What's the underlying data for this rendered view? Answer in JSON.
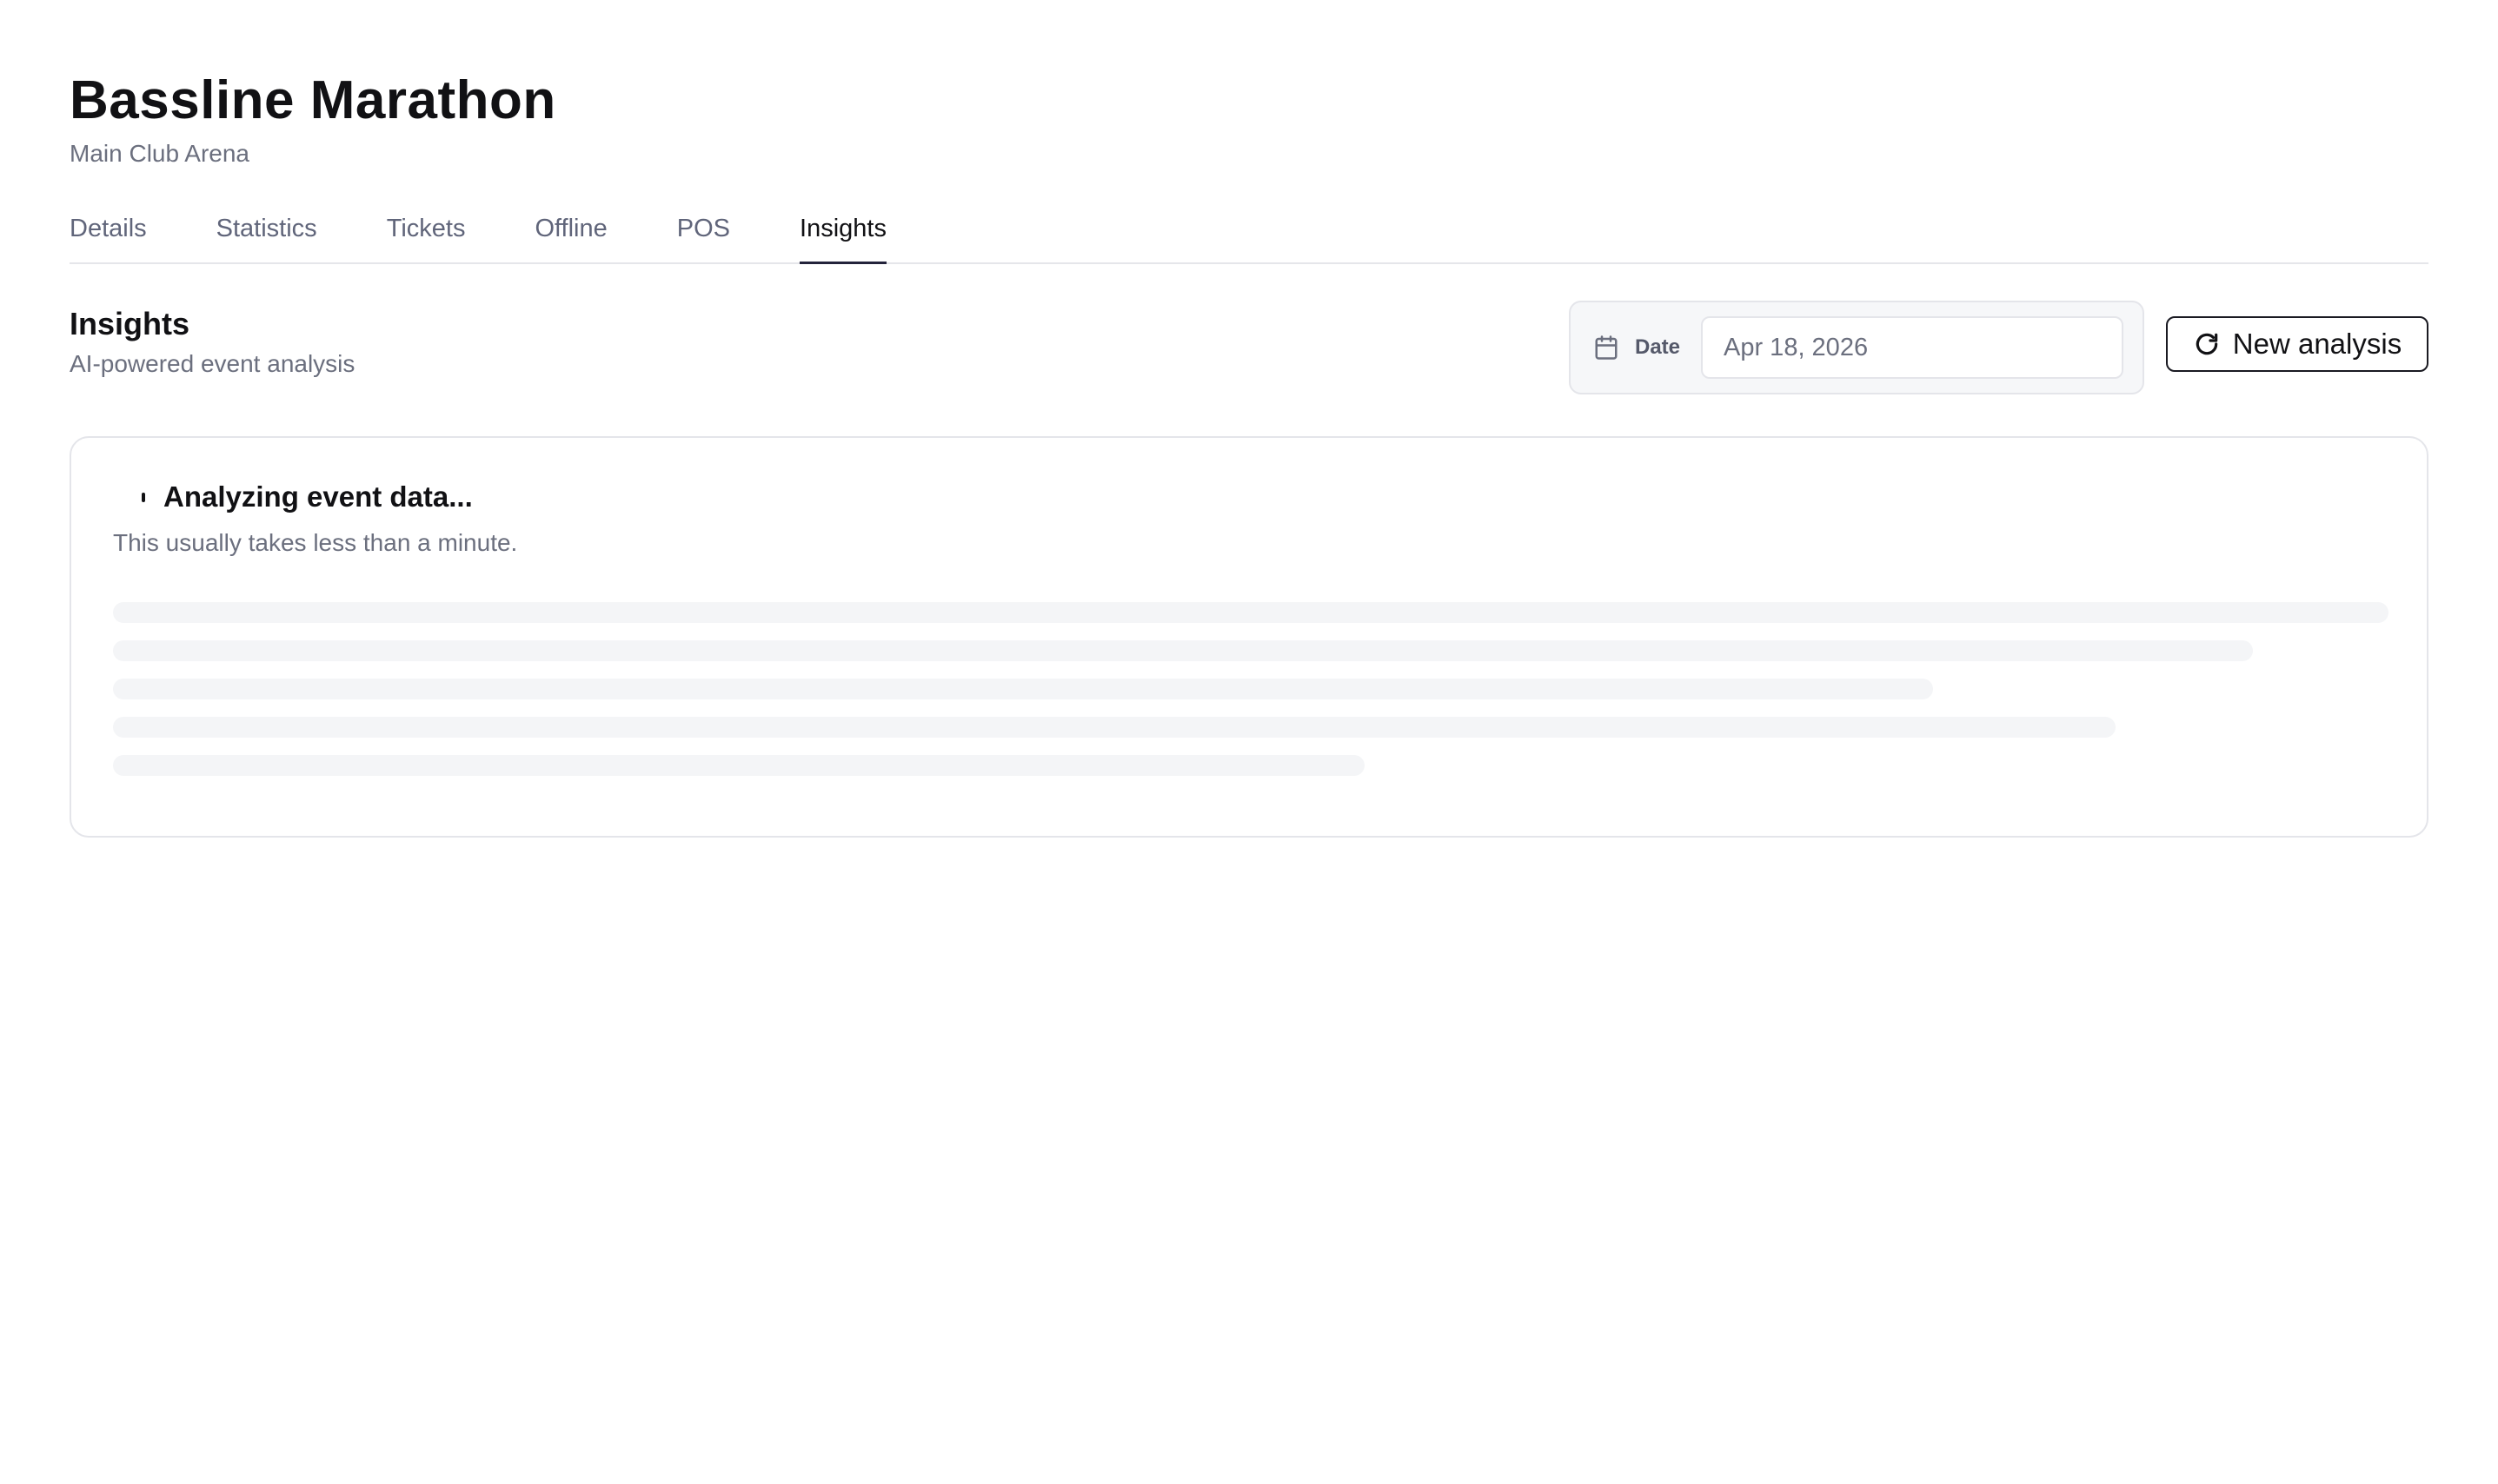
{
  "header": {
    "title": "Bassline Marathon",
    "subtitle": "Main Club Arena"
  },
  "tabs": [
    {
      "label": "Details",
      "active": false
    },
    {
      "label": "Statistics",
      "active": false
    },
    {
      "label": "Tickets",
      "active": false
    },
    {
      "label": "Offline",
      "active": false
    },
    {
      "label": "POS",
      "active": false
    },
    {
      "label": "Insights",
      "active": true
    }
  ],
  "insights": {
    "title": "Insights",
    "subtitle": "AI-powered event analysis",
    "date_label": "Date",
    "date_value": "Apr 18, 2026",
    "date_icon": "calendar-icon",
    "new_analysis_label": "New analysis",
    "new_analysis_icon": "refresh-icon"
  },
  "analysis_card": {
    "title": "Analyzing event data...",
    "subtitle": "This usually takes less than a minute.",
    "spinner_icon": "spinner-icon"
  },
  "colors": {
    "accent": "#23233b",
    "muted_text": "#6b6f7e",
    "border": "#e4e5ea",
    "skeleton": "#f4f5f7"
  }
}
